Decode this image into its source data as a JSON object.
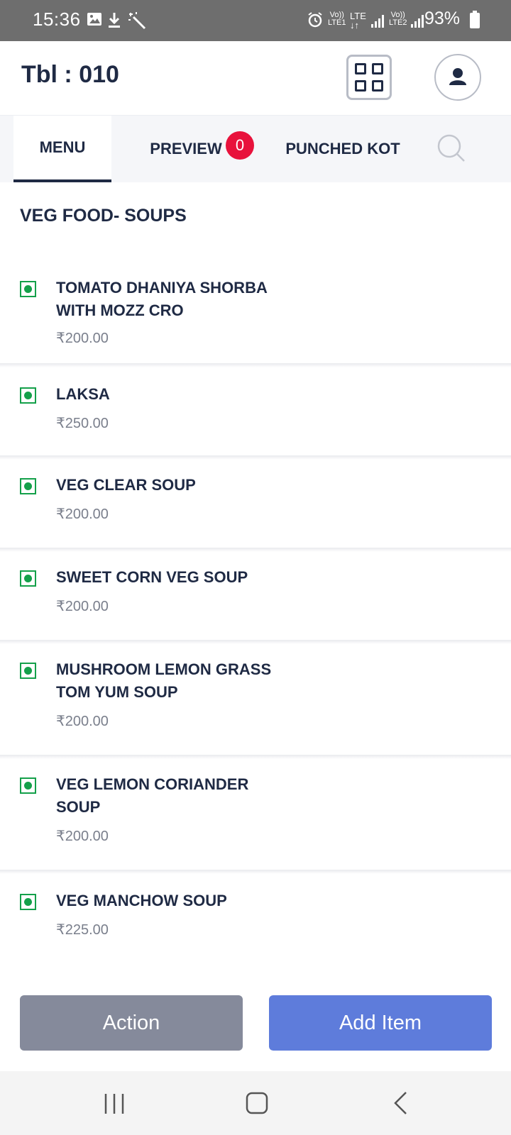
{
  "status_bar": {
    "time": "15:36",
    "left_icons": [
      "image-icon",
      "download-icon",
      "magic-wand-icon"
    ],
    "right_icons": [
      "alarm-icon",
      "volte-lte1-icon",
      "lte-icon",
      "signal-icon",
      "volte-lte2-icon",
      "signal-icon"
    ],
    "battery_text": "93%"
  },
  "header": {
    "table_label": "Tbl : 010",
    "grid_icon": "grid-icon",
    "profile_icon": "user-icon"
  },
  "tabs": [
    {
      "label": "MENU",
      "active": true
    },
    {
      "label": "PREVIEW",
      "badge": "0"
    },
    {
      "label": "PUNCHED KOT"
    }
  ],
  "search_icon": "search-icon",
  "section_title": "VEG FOOD- SOUPS",
  "items": [
    {
      "name": "TOMATO DHANIYA SHORBA WITH MOZZ CRO",
      "price": "₹200.00"
    },
    {
      "name": "LAKSA",
      "price": "₹250.00"
    },
    {
      "name": "VEG CLEAR SOUP",
      "price": "₹200.00"
    },
    {
      "name": "SWEET CORN VEG SOUP",
      "price": "₹200.00"
    },
    {
      "name": "MUSHROOM LEMON GRASS TOM YUM SOUP",
      "price": "₹200.00"
    },
    {
      "name": "VEG LEMON CORIANDER SOUP",
      "price": "₹200.00"
    },
    {
      "name": "VEG MANCHOW SOUP",
      "price": "₹225.00"
    }
  ],
  "buttons": {
    "action": "Action",
    "add_item": "Add Item"
  },
  "nav_bar": {
    "icons": [
      "recent-apps-icon",
      "home-icon",
      "back-icon"
    ]
  },
  "colors": {
    "status_bar": "#6e6e6e",
    "text_primary": "#1f2a44",
    "veg_green": "#14a04a",
    "badge_red": "#e8123c",
    "action_button": "#858a9b",
    "add_button": "#5e7cdb"
  }
}
